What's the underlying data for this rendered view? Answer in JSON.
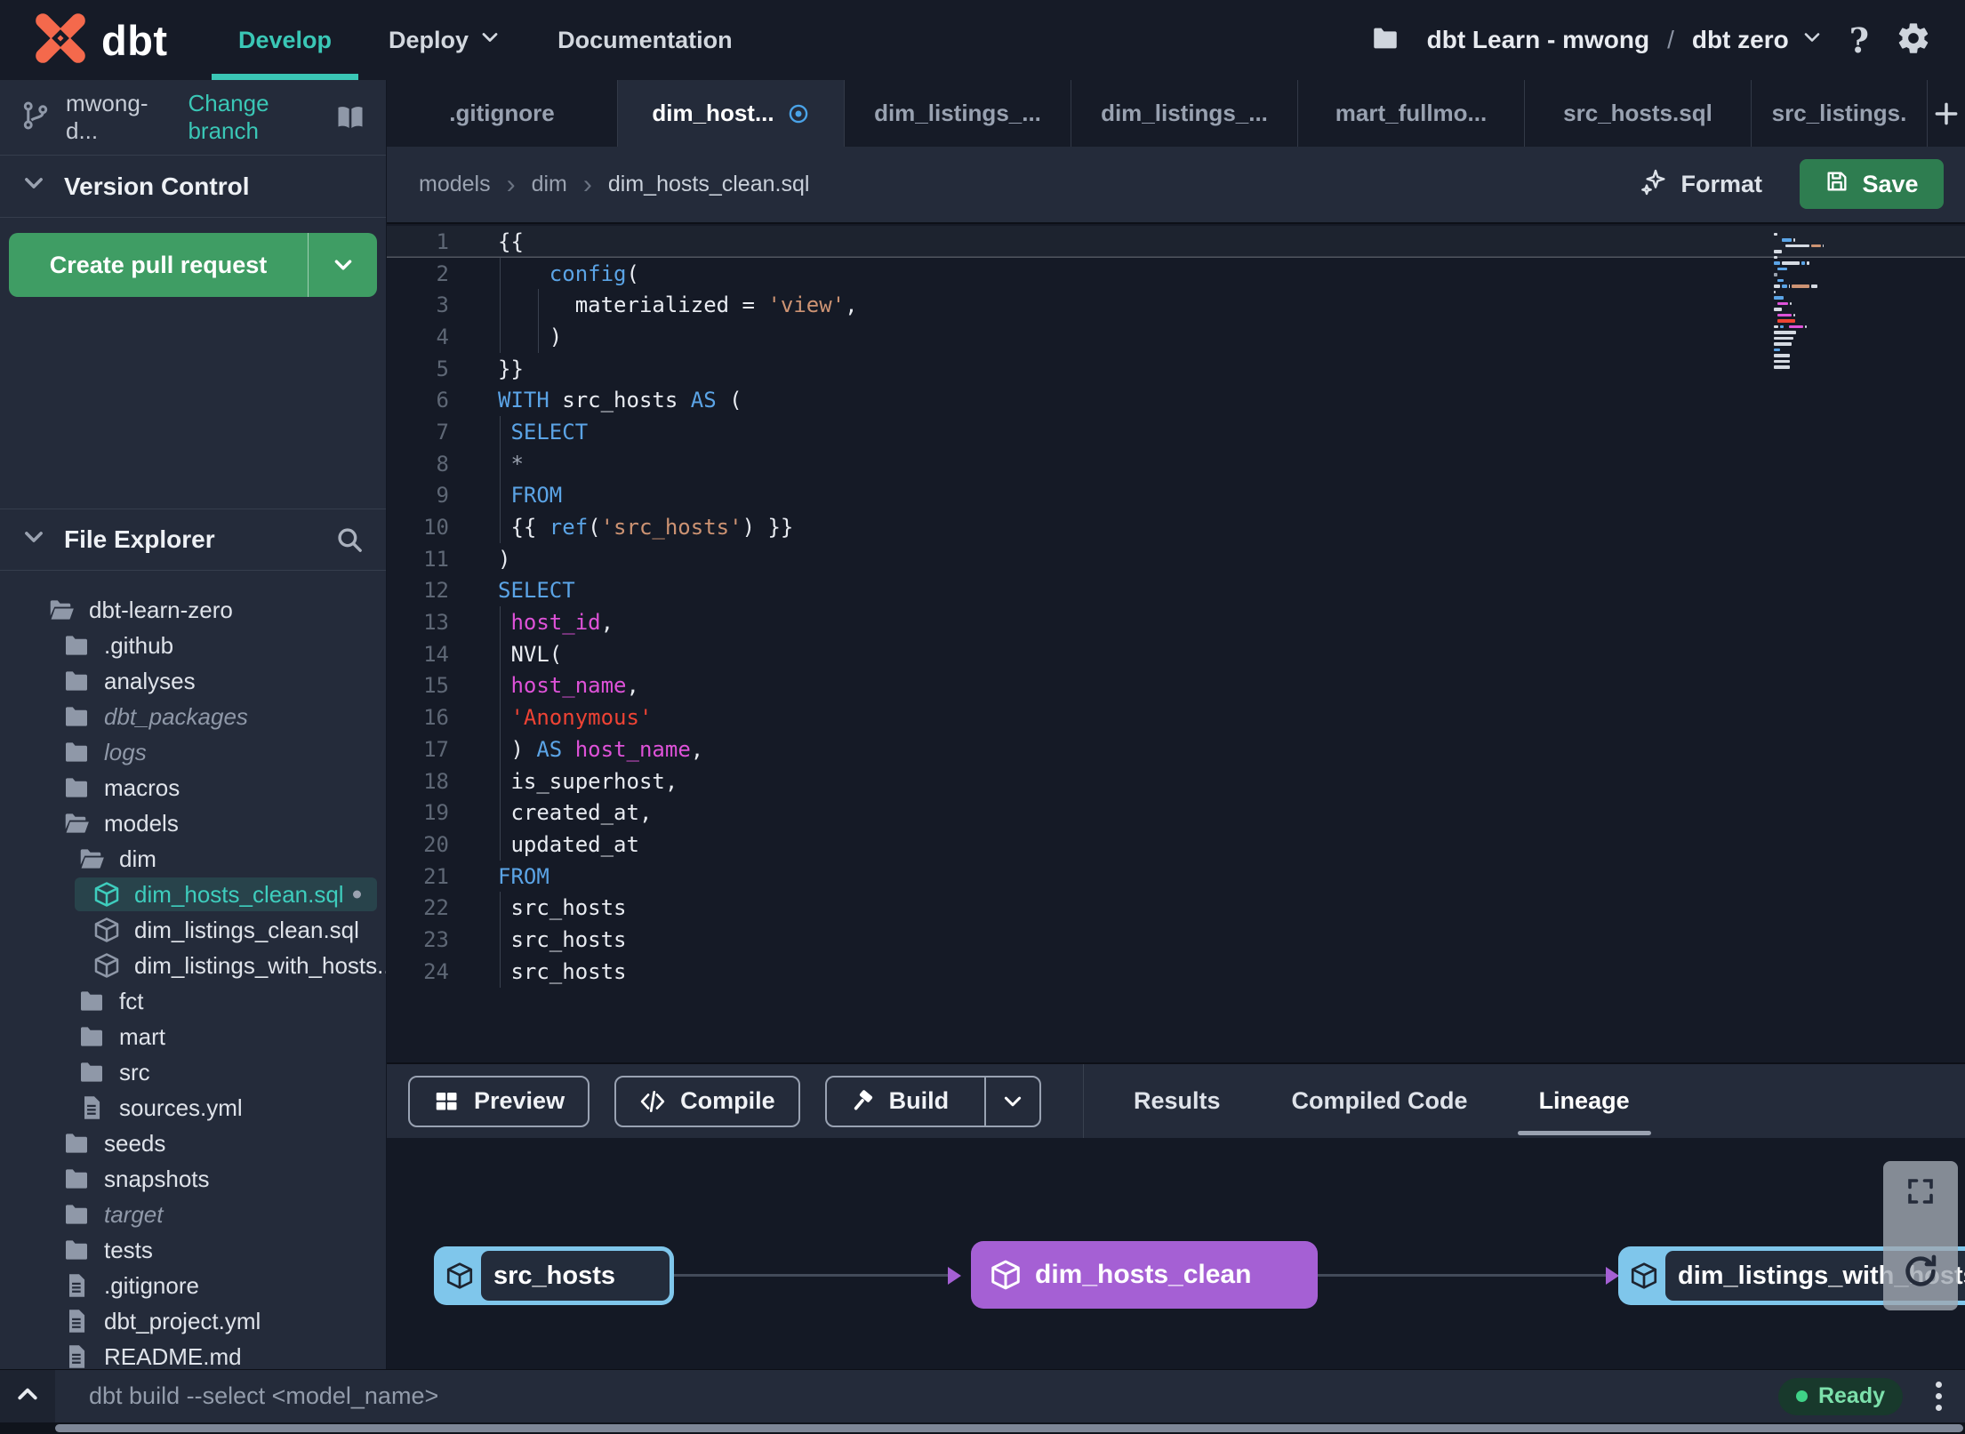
{
  "colors": {
    "accent_teal": "#3ac7b6",
    "brand_orange": "#f4694c",
    "create_pr_green": "#3f9d64",
    "save_green": "#2e7d50",
    "lineage_node_blue": "#7fc6eb",
    "lineage_node_purple": "#a560d4",
    "status_green": "#3fd287",
    "keyword_blue": "#5ba4e6",
    "string_tan": "#cd9373",
    "string_red": "#ee4334",
    "identifier_magenta": "#de52d8"
  },
  "navbar": {
    "logo_text": "dbt",
    "items": [
      {
        "label": "Develop",
        "active": true,
        "has_chevron": false
      },
      {
        "label": "Deploy",
        "active": false,
        "has_chevron": true
      },
      {
        "label": "Documentation",
        "active": false,
        "has_chevron": false
      }
    ],
    "project": {
      "account": "dbt Learn - mwong",
      "separator": "/",
      "name": "dbt zero"
    },
    "help_label": "?"
  },
  "sidebar": {
    "branch": {
      "name": "mwong-d...",
      "change_label": "Change branch"
    },
    "version_control": {
      "title": "Version Control",
      "create_pr_label": "Create pull request"
    },
    "file_explorer": {
      "title": "File Explorer",
      "tree": [
        {
          "name": "dbt-learn-zero",
          "type": "folder-open",
          "level": 0
        },
        {
          "name": ".github",
          "type": "folder",
          "level": 1
        },
        {
          "name": "analyses",
          "type": "folder",
          "level": 1
        },
        {
          "name": "dbt_packages",
          "type": "folder",
          "level": 1,
          "italic": true
        },
        {
          "name": "logs",
          "type": "folder",
          "level": 1,
          "italic": true
        },
        {
          "name": "macros",
          "type": "folder",
          "level": 1
        },
        {
          "name": "models",
          "type": "folder-open",
          "level": 1
        },
        {
          "name": "dim",
          "type": "folder-open",
          "level": 2
        },
        {
          "name": "dim_hosts_clean.sql",
          "type": "model",
          "level": 3,
          "selected": true,
          "dirty": true
        },
        {
          "name": "dim_listings_clean.sql",
          "type": "model",
          "level": 3
        },
        {
          "name": "dim_listings_with_hosts...",
          "type": "model",
          "level": 3
        },
        {
          "name": "fct",
          "type": "folder",
          "level": 2
        },
        {
          "name": "mart",
          "type": "folder",
          "level": 2
        },
        {
          "name": "src",
          "type": "folder",
          "level": 2
        },
        {
          "name": "sources.yml",
          "type": "file",
          "level": 2
        },
        {
          "name": "seeds",
          "type": "folder",
          "level": 1
        },
        {
          "name": "snapshots",
          "type": "folder",
          "level": 1
        },
        {
          "name": "target",
          "type": "folder",
          "level": 1,
          "italic": true
        },
        {
          "name": "tests",
          "type": "folder",
          "level": 1
        },
        {
          "name": ".gitignore",
          "type": "file",
          "level": 1
        },
        {
          "name": "dbt_project.yml",
          "type": "file",
          "level": 1
        },
        {
          "name": "README.md",
          "type": "file",
          "level": 1
        }
      ]
    }
  },
  "tabs": {
    "items": [
      {
        "label": ".gitignore"
      },
      {
        "label": "dim_host...",
        "active": true,
        "dirty": true
      },
      {
        "label": "dim_listings_..."
      },
      {
        "label": "dim_listings_..."
      },
      {
        "label": "mart_fullmo..."
      },
      {
        "label": "src_hosts.sql"
      },
      {
        "label": "src_listings."
      }
    ]
  },
  "breadcrumb": {
    "parts": [
      "models",
      "dim",
      "dim_hosts_clean.sql"
    ]
  },
  "toolbar": {
    "format_label": "Format",
    "save_label": "Save"
  },
  "editor": {
    "filename": "dim_hosts_clean.sql",
    "lines": [
      {
        "n": 1,
        "t": [
          [
            "{{",
            "w"
          ]
        ],
        "g": []
      },
      {
        "n": 2,
        "t": [
          [
            "    ",
            "w"
          ],
          [
            "config",
            "k"
          ],
          [
            "(",
            "w"
          ]
        ],
        "g": [
          0
        ]
      },
      {
        "n": 3,
        "t": [
          [
            "      ",
            "w"
          ],
          [
            "materialized = ",
            "w"
          ],
          [
            "'view'",
            "s"
          ],
          [
            ",",
            "w"
          ]
        ],
        "g": [
          0,
          3
        ]
      },
      {
        "n": 4,
        "t": [
          [
            "    )",
            "w"
          ]
        ],
        "g": [
          0,
          3
        ]
      },
      {
        "n": 5,
        "t": [
          [
            "}}",
            "w"
          ]
        ],
        "g": []
      },
      {
        "n": 6,
        "t": [
          [
            "WITH",
            "k"
          ],
          [
            " src_hosts ",
            "w"
          ],
          [
            "AS",
            "k"
          ],
          [
            " (",
            "w"
          ]
        ],
        "g": []
      },
      {
        "n": 7,
        "t": [
          [
            " ",
            "w"
          ],
          [
            "SELECT",
            "k"
          ]
        ],
        "g": [
          0
        ]
      },
      {
        "n": 8,
        "t": [
          [
            " *",
            "g"
          ]
        ],
        "g": [
          0
        ]
      },
      {
        "n": 9,
        "t": [
          [
            " ",
            "w"
          ],
          [
            "FROM",
            "k"
          ]
        ],
        "g": [
          0
        ]
      },
      {
        "n": 10,
        "t": [
          [
            " {{ ",
            "w"
          ],
          [
            "ref",
            "k"
          ],
          [
            "(",
            "w"
          ],
          [
            "'src_hosts'",
            "s"
          ],
          [
            ") }}",
            "w"
          ]
        ],
        "g": [
          0
        ]
      },
      {
        "n": 11,
        "t": [
          [
            ")",
            "w"
          ]
        ],
        "g": []
      },
      {
        "n": 12,
        "t": [
          [
            "SELECT",
            "k"
          ]
        ],
        "g": []
      },
      {
        "n": 13,
        "t": [
          [
            " ",
            "w"
          ],
          [
            "host_id",
            "m"
          ],
          [
            ",",
            "w"
          ]
        ],
        "g": [
          0
        ]
      },
      {
        "n": 14,
        "t": [
          [
            " NVL(",
            "w"
          ]
        ],
        "g": [
          0
        ]
      },
      {
        "n": 15,
        "t": [
          [
            " ",
            "w"
          ],
          [
            "host_name",
            "m"
          ],
          [
            ",",
            "w"
          ]
        ],
        "g": [
          0
        ]
      },
      {
        "n": 16,
        "t": [
          [
            " ",
            "w"
          ],
          [
            "'Anonymous'",
            "r"
          ]
        ],
        "g": [
          0
        ]
      },
      {
        "n": 17,
        "t": [
          [
            " ) ",
            "w"
          ],
          [
            "AS",
            "k"
          ],
          [
            " ",
            "w"
          ],
          [
            "host_name",
            "m"
          ],
          [
            ",",
            "w"
          ]
        ],
        "g": [
          0
        ]
      },
      {
        "n": 18,
        "t": [
          [
            " is_superhost,",
            "w"
          ]
        ],
        "g": [
          0
        ]
      },
      {
        "n": 19,
        "t": [
          [
            " created_at,",
            "w"
          ]
        ],
        "g": [
          0
        ]
      },
      {
        "n": 20,
        "t": [
          [
            " updated_at",
            "w"
          ]
        ],
        "g": [
          0
        ]
      },
      {
        "n": 21,
        "t": [
          [
            "FROM",
            "k"
          ]
        ],
        "g": []
      },
      {
        "n": 22,
        "t": [
          [
            " src_hosts",
            "w"
          ]
        ],
        "g": [
          0
        ]
      },
      {
        "n": 23,
        "t": [
          [
            " src_hosts",
            "w"
          ]
        ],
        "g": [
          0
        ]
      },
      {
        "n": 24,
        "t": [
          [
            " src_hosts",
            "w"
          ]
        ],
        "g": [
          0
        ]
      }
    ]
  },
  "panel": {
    "buttons": [
      {
        "label": "Preview",
        "icon": "table"
      },
      {
        "label": "Compile",
        "icon": "code"
      },
      {
        "label": "Build",
        "icon": "hammer",
        "split_chevron": true
      }
    ],
    "tabs": [
      {
        "label": "Results"
      },
      {
        "label": "Compiled Code"
      },
      {
        "label": "Lineage",
        "active": true
      }
    ]
  },
  "lineage": {
    "nodes": [
      {
        "label": "src_hosts",
        "style": "source"
      },
      {
        "label": "dim_hosts_clean",
        "style": "selected"
      },
      {
        "label": "dim_listings_with_hosts",
        "style": "source"
      }
    ]
  },
  "statusbar": {
    "command_placeholder": "dbt build --select <model_name>",
    "status_label": "Ready"
  }
}
